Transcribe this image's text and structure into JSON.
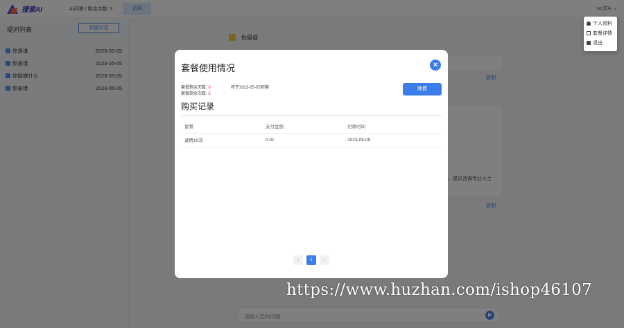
{
  "header": {
    "logo_text": "搜索AI",
    "quota_text": "AI问答 / 剩余次数: 3",
    "top_button": "试用",
    "user_name": "wu文A",
    "user_chevron": "⌄"
  },
  "user_menu": {
    "items": [
      {
        "label": "个人资料",
        "icon": "person-icon"
      },
      {
        "label": "套餐详情",
        "icon": "card-icon"
      },
      {
        "label": "退出",
        "icon": "logout-icon"
      }
    ]
  },
  "sidebar": {
    "title": "提问列表",
    "new_chat": "新建对话",
    "conversations": [
      {
        "title": "你是谁",
        "date": "2023-05-05"
      },
      {
        "title": "你是谁",
        "date": "2023-05-05"
      },
      {
        "title": "你能做什么",
        "date": "2023-05-05"
      },
      {
        "title": "你是谁",
        "date": "2023-05-05"
      }
    ]
  },
  "chat": {
    "message1": "你是谁",
    "action_copy": "复制",
    "answer_tail": "，建议咨询专业人士",
    "action_copy2": "复制",
    "input_placeholder": "请输入您的问题"
  },
  "modal": {
    "title": "套餐使用情况",
    "close_glyph": "×",
    "total_label": "套餐剩余天数: ",
    "total_value": "0",
    "remaining_label": "套餐剩余次数: ",
    "remaining_value": "3",
    "expire_text": "将于2023-05-05到期",
    "renew_button": "续费",
    "records_title": "购买记录",
    "columns": [
      "套餐",
      "支付金额",
      "付款时间"
    ],
    "rows": [
      [
        "试用10次",
        "0.01",
        "2023-05-05"
      ]
    ],
    "pagination": {
      "prev": "‹",
      "current": "1",
      "next": "›"
    }
  },
  "watermark": "https://www.huzhan.com/ishop46107"
}
